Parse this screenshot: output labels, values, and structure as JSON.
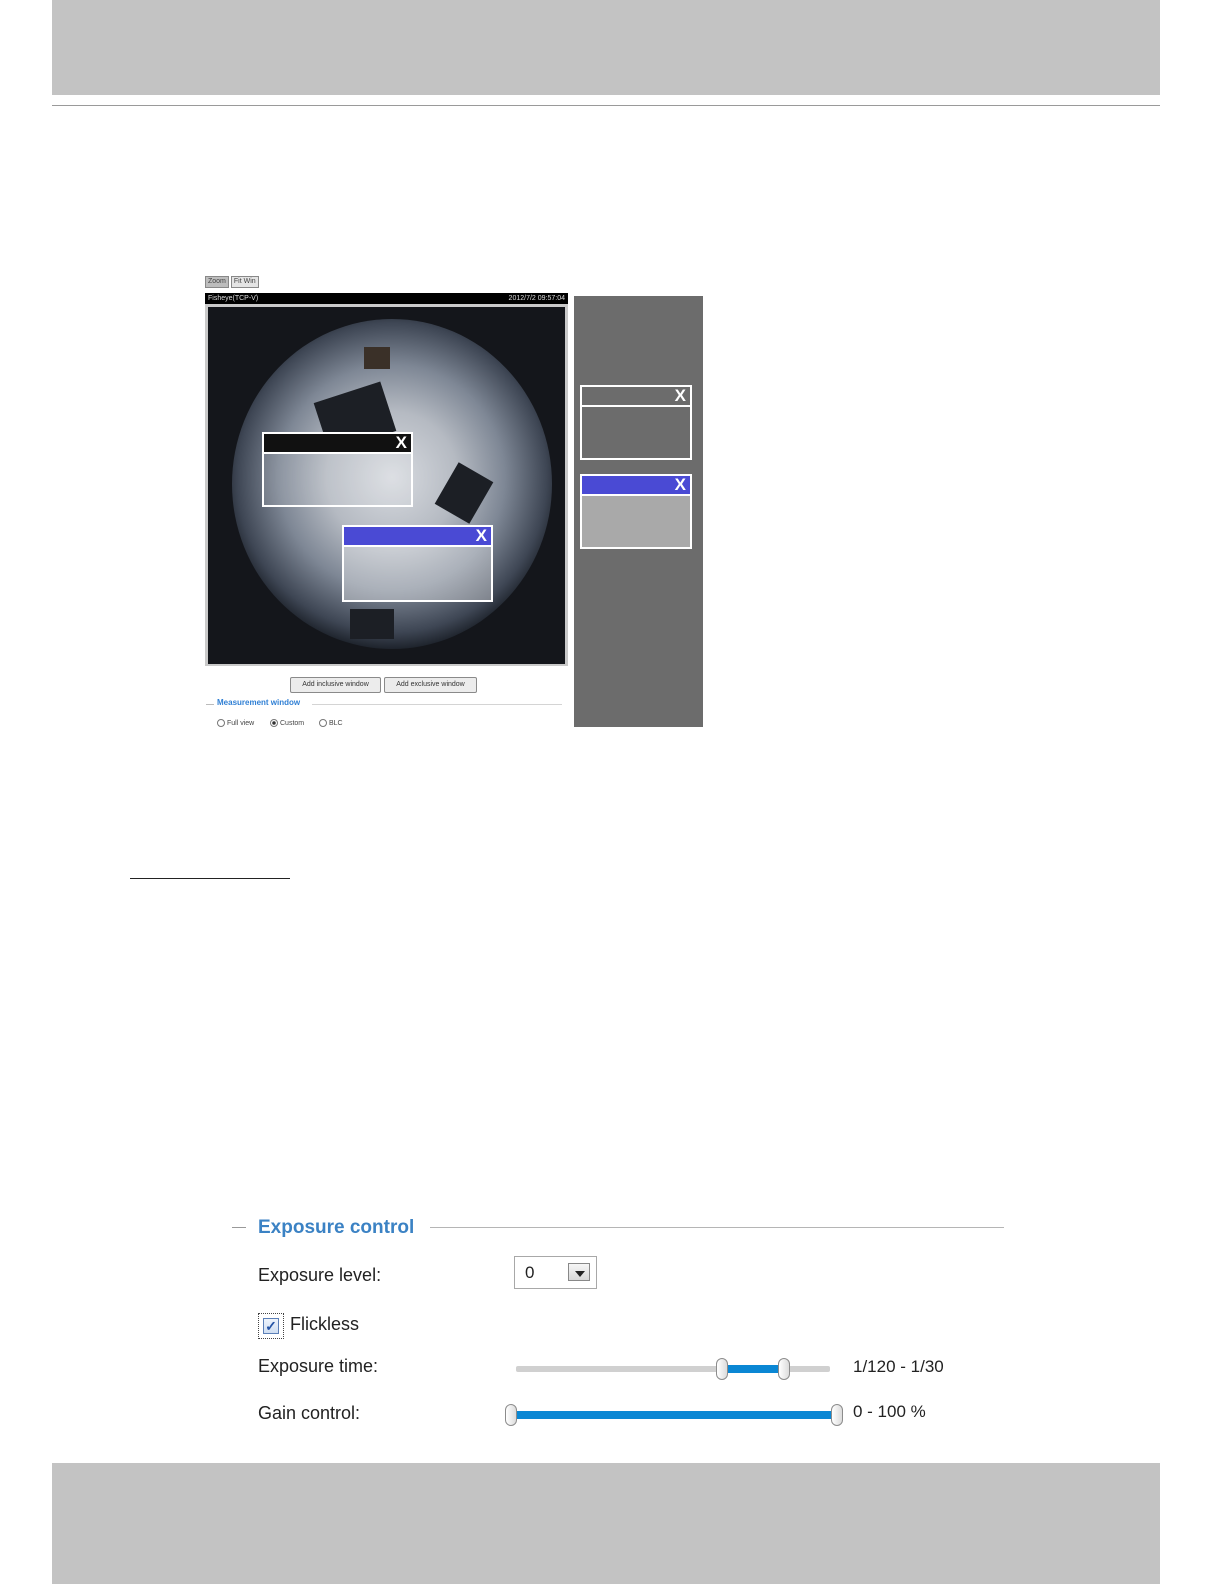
{
  "viewer": {
    "tabs": [
      "Zoom",
      "Fit Win"
    ],
    "video_title": "Fisheye(TCP-V)",
    "video_timestamp": "2012/7/2 09:57:04",
    "buttons": {
      "add_inclusive": "Add inclusive window",
      "add_exclusive": "Add exclusive window"
    },
    "measurement_window": {
      "legend": "Measurement window",
      "options": [
        "Full view",
        "Custom",
        "BLC"
      ],
      "selected": "Custom"
    },
    "roi_close_glyph": "X",
    "colors": {
      "exclusive_bar": "#4a4ad4",
      "panel": "#6c6c6c"
    }
  },
  "exposure": {
    "title": "Exposure control",
    "level_label": "Exposure level:",
    "level_value": "0",
    "flickless_label": "Flickless",
    "flickless_checked": true,
    "flickless_mark": "✓",
    "time_label": "Exposure time:",
    "time_value": "1/120 - 1/30",
    "gain_label": "Gain control:",
    "gain_value": "0 - 100 %",
    "accent": "#3b82c4"
  }
}
